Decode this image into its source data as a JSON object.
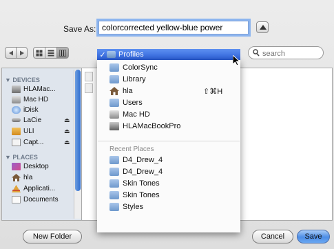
{
  "save_as": {
    "label": "Save As:",
    "filename": "colorcorrected yellow-blue power"
  },
  "toolbar": {
    "search_placeholder": "search"
  },
  "sidebar": {
    "devices_heading": "▼ DEVICES",
    "places_heading": "▼ PLACES",
    "devices": [
      {
        "label": "HLAMac...",
        "icon": "laptop-icon"
      },
      {
        "label": "Mac HD",
        "icon": "harddisk-icon"
      },
      {
        "label": "iDisk",
        "icon": "idisk-icon"
      },
      {
        "label": "LaCie",
        "icon": "drive-icon",
        "eject": "⏏"
      },
      {
        "label": "ULI",
        "icon": "usb-drive-icon",
        "eject": "⏏"
      },
      {
        "label": "Capt...",
        "icon": "drive-icon",
        "eject": "⏏"
      }
    ],
    "places": [
      {
        "label": "Desktop",
        "icon": "desktop-icon"
      },
      {
        "label": "hla",
        "icon": "home-icon"
      },
      {
        "label": "Applicati...",
        "icon": "applications-icon"
      },
      {
        "label": "Documents",
        "icon": "documents-icon"
      }
    ]
  },
  "menu": {
    "current": {
      "check": "✓",
      "label": "Profiles",
      "icon": "folder-icon"
    },
    "path_items": [
      {
        "label": "ColorSync",
        "icon": "folder-icon"
      },
      {
        "label": "Library",
        "icon": "folder-icon"
      },
      {
        "label": "hla",
        "icon": "home-icon",
        "shortcut": "⇧⌘H"
      },
      {
        "label": "Users",
        "icon": "folder-icon"
      },
      {
        "label": "Mac HD",
        "icon": "harddisk-icon"
      },
      {
        "label": "HLAMacBookPro",
        "icon": "laptop-icon"
      }
    ],
    "recent_heading": "Recent Places",
    "recent_items": [
      {
        "label": "D4_Drew_4",
        "icon": "folder-icon"
      },
      {
        "label": "D4_Drew_4",
        "icon": "folder-icon"
      },
      {
        "label": "Skin Tones",
        "icon": "folder-icon"
      },
      {
        "label": "Skin Tones",
        "icon": "folder-icon"
      },
      {
        "label": "Styles",
        "icon": "folder-icon"
      }
    ]
  },
  "buttons": {
    "new_folder": "New Folder",
    "cancel": "Cancel",
    "save": "Save"
  },
  "colors": {
    "accent": "#3b6fdc",
    "sidebar_bg": "#dfe5ed",
    "dialog_bg": "#e6e6e6"
  }
}
